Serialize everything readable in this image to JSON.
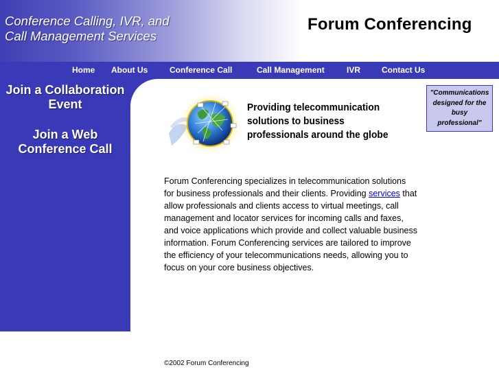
{
  "header": {
    "tagline_line1": "Conference Calling, IVR, and",
    "tagline_line2": "Call Management Services",
    "brand": "Forum Conferencing"
  },
  "nav": {
    "items": [
      {
        "label": "Home"
      },
      {
        "label": "About Us"
      },
      {
        "label": "Conference Call"
      },
      {
        "label": "Call Management"
      },
      {
        "label": "IVR"
      },
      {
        "label": "Contact Us"
      }
    ]
  },
  "sidebar": {
    "link1_line1": "Join a Collaboration",
    "link1_line2": "Event",
    "link2_line1": "Join a Web",
    "link2_line2": "Conference Call"
  },
  "quote": {
    "line1": "\"Communications",
    "line2": "designed for the",
    "line3": "busy",
    "line4": "professional\""
  },
  "hero": {
    "line1": "Providing telecommunication",
    "line2": "solutions to business",
    "line3": "professionals around the globe"
  },
  "body": {
    "text_before": "Forum Conferencing specializes in telecommunication solutions for business professionals and their clients. Providing ",
    "link": "services",
    "text_after": " that allow professionals and clients access to virtual meetings, call management and locator services for incoming calls and faxes, and voice applications which provide and collect valuable business information. Forum Conferencing services are tailored to improve the efficiency of your telecommunications needs, allowing you to focus on your core business objectives."
  },
  "footer": {
    "copyright": "©2002 Forum Conferencing"
  },
  "colors": {
    "brand_blue": "#3a3ab8",
    "quote_bg": "#c9c9ee",
    "link": "#0000ee"
  }
}
